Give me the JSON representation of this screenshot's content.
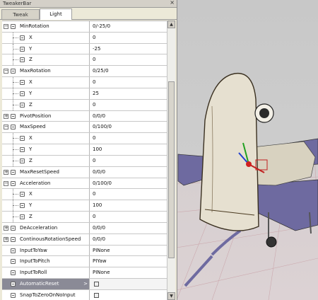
{
  "window": {
    "title": "TweakerBar",
    "close_glyph": "×"
  },
  "tabs": [
    {
      "label": "Tweak",
      "active": false
    },
    {
      "label": "Light",
      "active": true
    }
  ],
  "rows": [
    {
      "type": "group",
      "expanded": true,
      "name": "MinRotation",
      "value": "0/-25/0"
    },
    {
      "type": "child",
      "name": "X",
      "value": "0"
    },
    {
      "type": "child",
      "name": "Y",
      "value": "-25"
    },
    {
      "type": "child",
      "name": "Z",
      "value": "0"
    },
    {
      "type": "group",
      "expanded": true,
      "name": "MaxRotation",
      "value": "0/25/0"
    },
    {
      "type": "child",
      "name": "X",
      "value": "0"
    },
    {
      "type": "child",
      "name": "Y",
      "value": "25"
    },
    {
      "type": "child",
      "name": "Z",
      "value": "0"
    },
    {
      "type": "group",
      "expanded": false,
      "name": "PivotPosition",
      "value": "0/0/0"
    },
    {
      "type": "group",
      "expanded": true,
      "name": "MaxSpeed",
      "value": "0/100/0"
    },
    {
      "type": "child",
      "name": "X",
      "value": "0"
    },
    {
      "type": "child",
      "name": "Y",
      "value": "100"
    },
    {
      "type": "child",
      "name": "Z",
      "value": "0"
    },
    {
      "type": "group",
      "expanded": false,
      "name": "MaxResetSpeed",
      "value": "0/0/0"
    },
    {
      "type": "group",
      "expanded": true,
      "name": "Acceleration",
      "value": "0/100/0"
    },
    {
      "type": "child",
      "name": "X",
      "value": "0"
    },
    {
      "type": "child",
      "name": "Y",
      "value": "100"
    },
    {
      "type": "child",
      "name": "Z",
      "value": "0"
    },
    {
      "type": "group",
      "expanded": false,
      "name": "DeAcceleration",
      "value": "0/0/0"
    },
    {
      "type": "group",
      "expanded": false,
      "name": "ContinousRotationSpeed",
      "value": "0/0/0"
    },
    {
      "type": "leaf",
      "name": "InputToYaw",
      "value": "PINone"
    },
    {
      "type": "leaf",
      "name": "InputToPitch",
      "value": "PIYaw"
    },
    {
      "type": "leaf",
      "name": "InputToRoll",
      "value": "PINone"
    },
    {
      "type": "leaf-check",
      "name": "AutomaticReset",
      "selected": true,
      "checked": false
    },
    {
      "type": "leaf-check",
      "name": "SnapToZeroOnNoInput",
      "checked": false
    }
  ],
  "glyphs": {
    "expanded": "−",
    "collapsed": "+",
    "scroll_up": "▲",
    "scroll_down": "▼",
    "select_arrow": ">"
  },
  "colors": {
    "selected_row": "#8a8a96",
    "panel_bg": "#ece9d8",
    "sky": "#c8c8c8",
    "ground_grid": "#c89aa0"
  }
}
